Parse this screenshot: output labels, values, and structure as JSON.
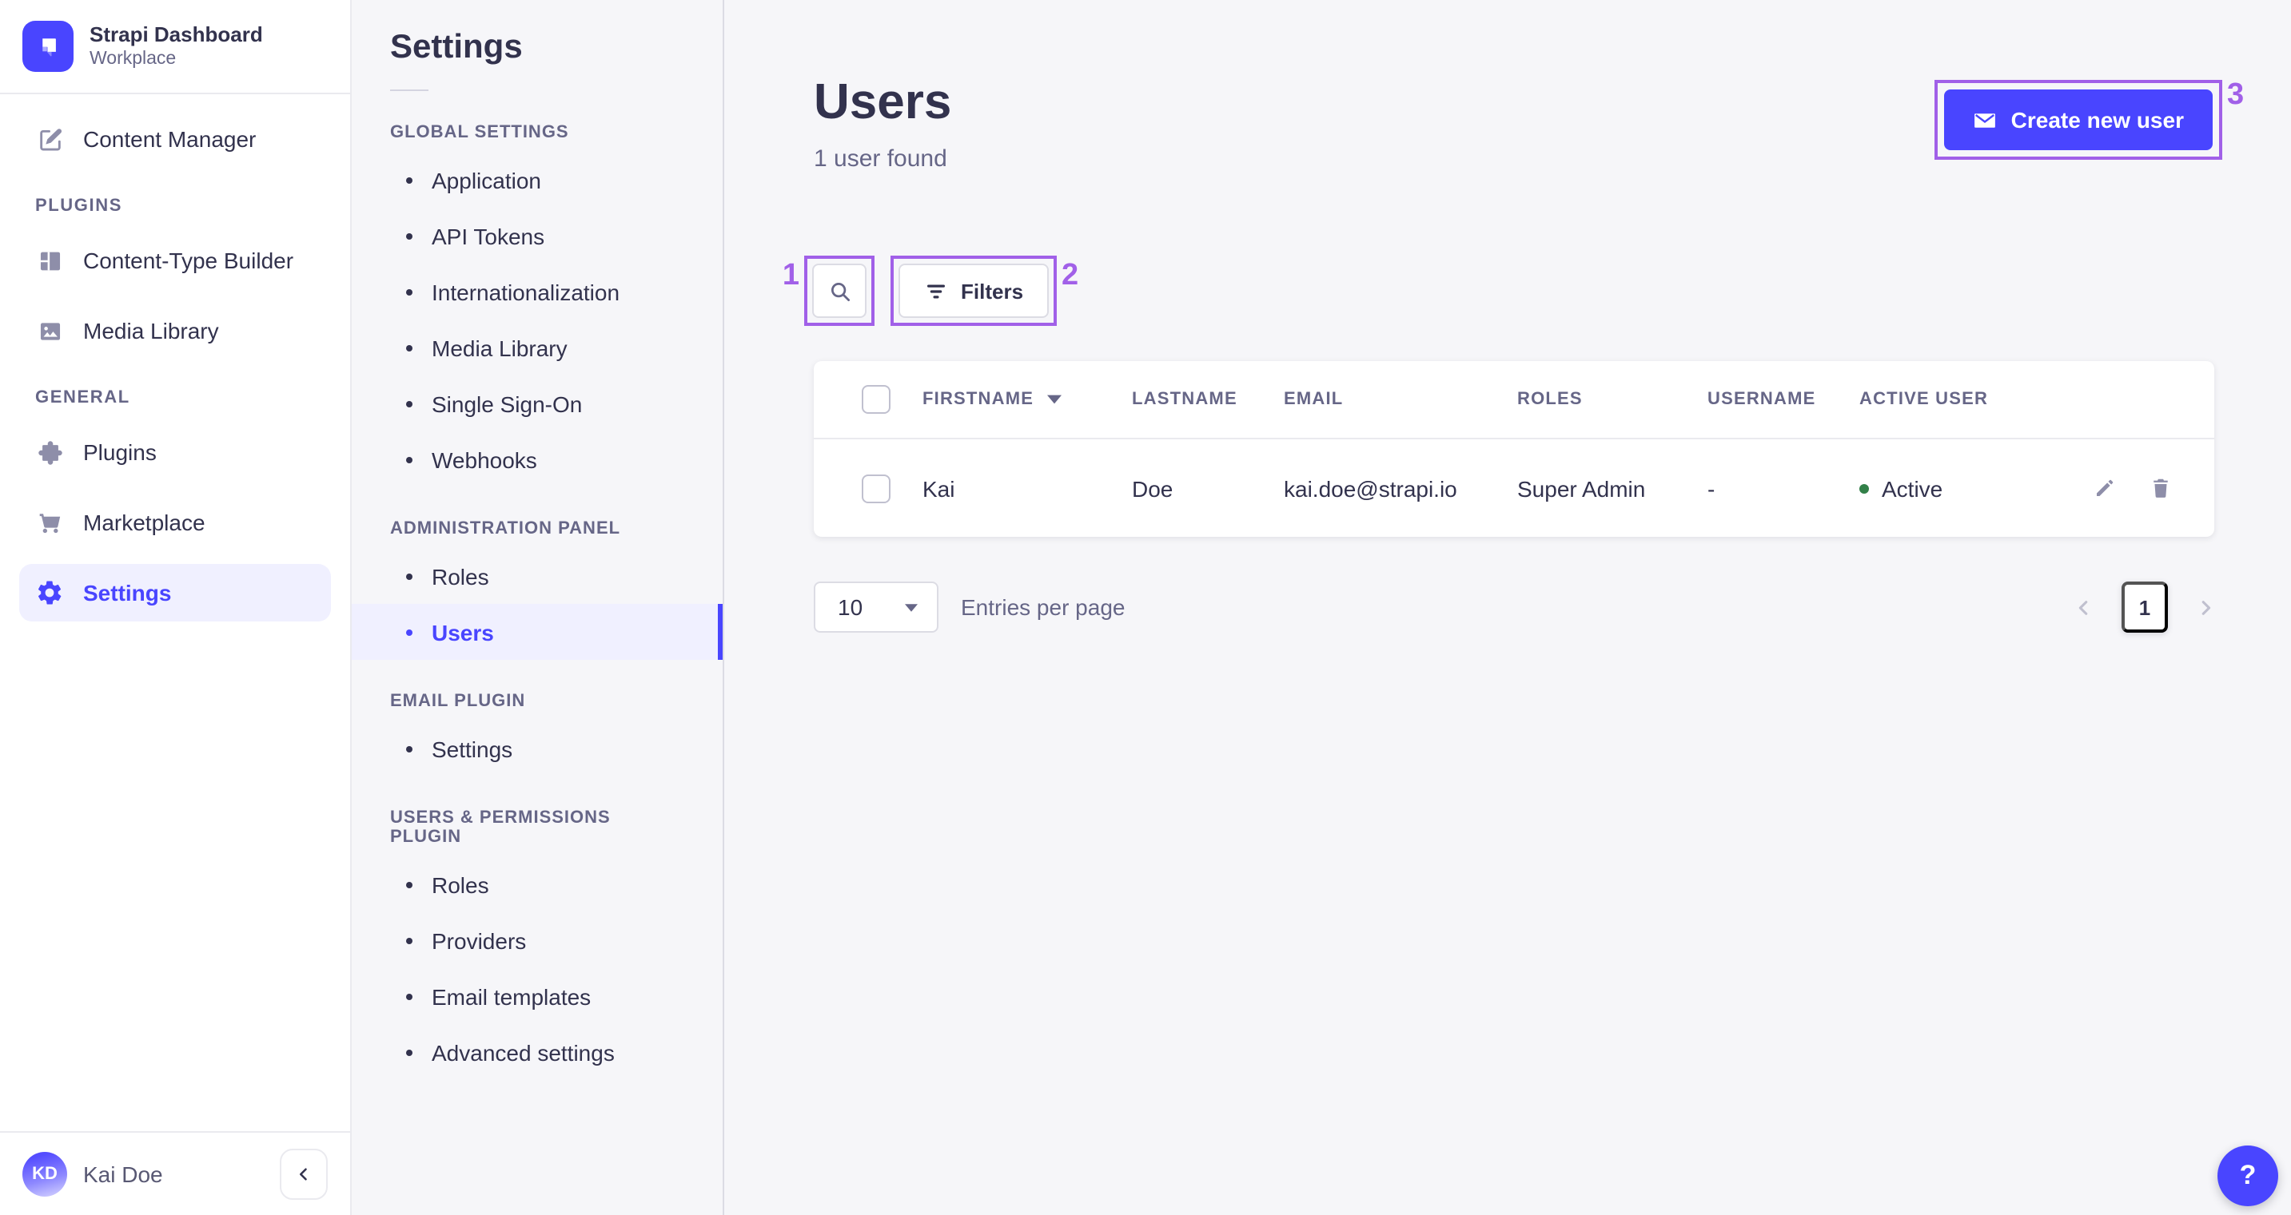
{
  "brand": {
    "title": "Strapi Dashboard",
    "subtitle": "Workplace"
  },
  "sidebar": {
    "content_manager": "Content Manager",
    "sections": [
      {
        "label": "PLUGINS",
        "items": [
          {
            "label": "Content-Type Builder"
          },
          {
            "label": "Media Library"
          }
        ]
      },
      {
        "label": "GENERAL",
        "items": [
          {
            "label": "Plugins"
          },
          {
            "label": "Marketplace"
          },
          {
            "label": "Settings"
          }
        ]
      }
    ],
    "user": {
      "initials": "KD",
      "name": "Kai Doe"
    }
  },
  "subnav": {
    "title": "Settings",
    "sections": [
      {
        "label": "GLOBAL SETTINGS",
        "items": [
          "Application",
          "API Tokens",
          "Internationalization",
          "Media Library",
          "Single Sign-On",
          "Webhooks"
        ]
      },
      {
        "label": "ADMINISTRATION PANEL",
        "items": [
          "Roles",
          "Users"
        ]
      },
      {
        "label": "EMAIL PLUGIN",
        "items": [
          "Settings"
        ]
      },
      {
        "label": "USERS & PERMISSIONS PLUGIN",
        "items": [
          "Roles",
          "Providers",
          "Email templates",
          "Advanced settings"
        ]
      }
    ],
    "active_item": "Users"
  },
  "main": {
    "title": "Users",
    "subtitle": "1 user found",
    "create_button_label": "Create new user",
    "filters_button_label": "Filters",
    "table": {
      "headers": [
        "FIRSTNAME",
        "LASTNAME",
        "EMAIL",
        "ROLES",
        "USERNAME",
        "ACTIVE USER"
      ],
      "rows": [
        {
          "firstname": "Kai",
          "lastname": "Doe",
          "email": "kai.doe@strapi.io",
          "roles": "Super Admin",
          "username": "-",
          "status": "Active"
        }
      ]
    },
    "pagination": {
      "page_size": "10",
      "entries_label": "Entries per page",
      "current_page": "1"
    },
    "help_label": "?"
  },
  "annotations": {
    "search_box": "1",
    "filters_box": "2",
    "create_box": "3"
  },
  "colors": {
    "accent": "#4945FF",
    "annotation": "#A160E8",
    "status_active": "#328048",
    "active_item_bg": "#F0F0FF"
  }
}
